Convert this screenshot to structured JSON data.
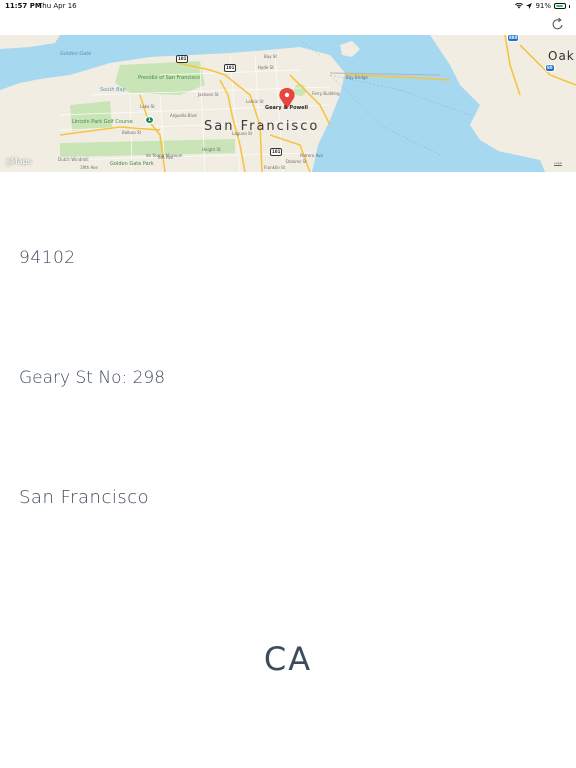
{
  "status_bar": {
    "time": "11:57 PM",
    "date": "Thu Apr 16",
    "battery": "91%",
    "battery_level": 0.91
  },
  "nav_bar": {
    "refresh_icon": "refresh-icon"
  },
  "map": {
    "city_label": "San Francisco",
    "pin_label": "Geary & Powell",
    "oakland_label": "Oak",
    "attribution": "Maps",
    "legal_label": "Legal",
    "water_labels": [
      "Golden Gate",
      "South Bay"
    ],
    "park_labels": [
      "Presidio of San Francisco",
      "Lincoln Park Golf Course",
      "Golden Gate Park"
    ],
    "street_labels": [
      "Lake St",
      "Balboa St",
      "Jackson St",
      "Haight St",
      "Bay St",
      "Hyde St",
      "Larkin St",
      "Laguna St",
      "Franklin St",
      "Arguello Blvd",
      "6th Ave",
      "19th Ave",
      "Dolores St",
      "Potrero Ave"
    ],
    "landmark_labels": [
      "Ferry Building",
      "Bay Bridge",
      "Dutch Windmill",
      "de Young Museum"
    ],
    "highway_shields": [
      "101",
      "101",
      "101",
      "1",
      "880",
      "80"
    ],
    "pin_color": "#e8453c",
    "water_color": "#a6d8f0",
    "land_color": "#f2ede3"
  },
  "address": {
    "zip": "94102",
    "street": "Geary St No: 298",
    "city": "San Francisco",
    "state": "CA"
  },
  "colors": {
    "text": "#3e4b5e"
  }
}
